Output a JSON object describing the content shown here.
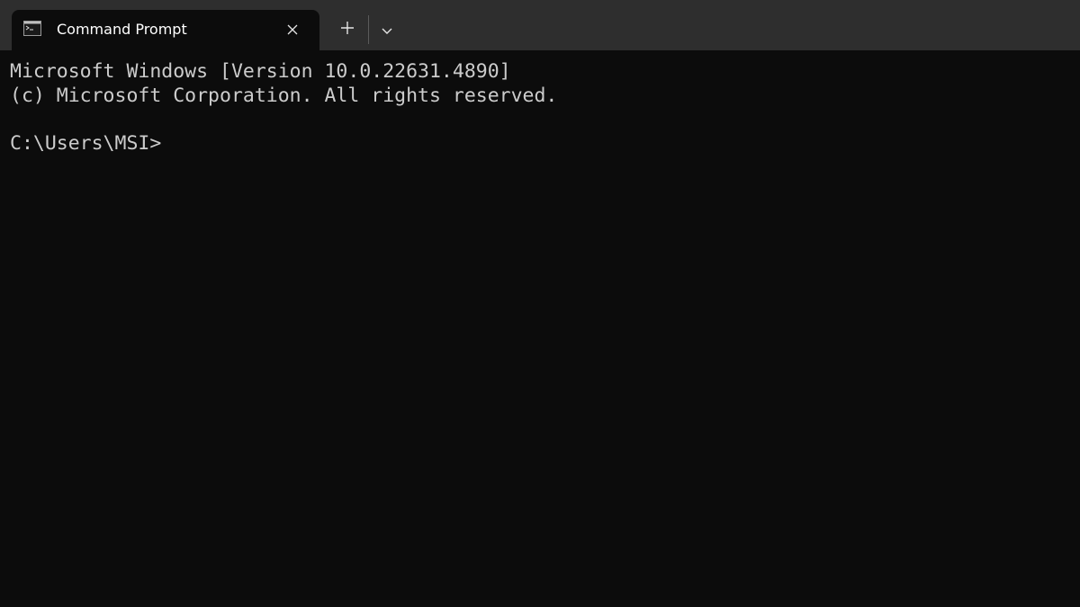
{
  "tab": {
    "title": "Command Prompt",
    "icon": "console-icon"
  },
  "controls": {
    "close_icon": "close-icon",
    "new_tab_icon": "plus-icon",
    "dropdown_icon": "chevron-down-icon"
  },
  "terminal": {
    "lines": [
      "Microsoft Windows [Version 10.0.22631.4890]",
      "(c) Microsoft Corporation. All rights reserved.",
      "",
      "C:\\Users\\MSI>"
    ]
  },
  "colors": {
    "tabbar_bg": "#2e2e2e",
    "terminal_bg": "#0c0c0c",
    "terminal_text": "#cccccc",
    "tab_text": "#ffffff"
  }
}
